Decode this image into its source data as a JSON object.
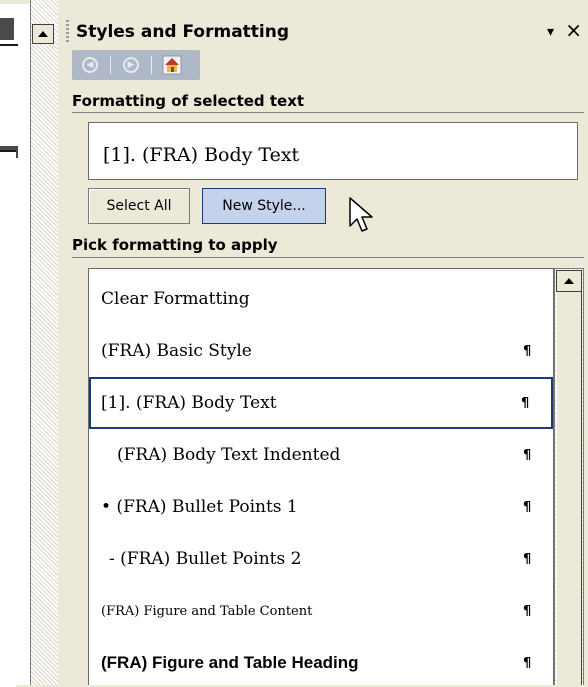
{
  "pane": {
    "title": "Styles and Formatting",
    "menu_arrow": "▾",
    "close": "×"
  },
  "nav": {
    "back_icon": "back-icon",
    "forward_icon": "forward-icon",
    "home_icon": "home-icon"
  },
  "sections": {
    "formatting_selected": "Formatting of selected text",
    "pick_formatting": "Pick formatting to apply"
  },
  "selected_text": "[1].  (FRA) Body Text",
  "buttons": {
    "select_all": "Select All",
    "new_style": "New Style..."
  },
  "styles": [
    {
      "label": "Clear Formatting",
      "mark": ""
    },
    {
      "label": "(FRA) Basic Style",
      "mark": "¶"
    },
    {
      "label": "[1].  (FRA) Body Text",
      "mark": "¶"
    },
    {
      "label": "(FRA) Body Text Indented",
      "mark": "¶"
    },
    {
      "label": "•  (FRA) Bullet Points 1",
      "mark": "¶"
    },
    {
      "label": "-  (FRA) Bullet Points 2",
      "mark": "¶"
    },
    {
      "label": "(FRA) Figure and Table Content",
      "mark": "¶"
    },
    {
      "label": "(FRA) Figure and Table Heading",
      "mark": "¶"
    }
  ],
  "colors": {
    "selection_border": "#1f3a7a",
    "new_style_bg": "#c4d2ec",
    "nav_bg": "#aeb8c6",
    "pane_bg": "#ece9d8"
  }
}
